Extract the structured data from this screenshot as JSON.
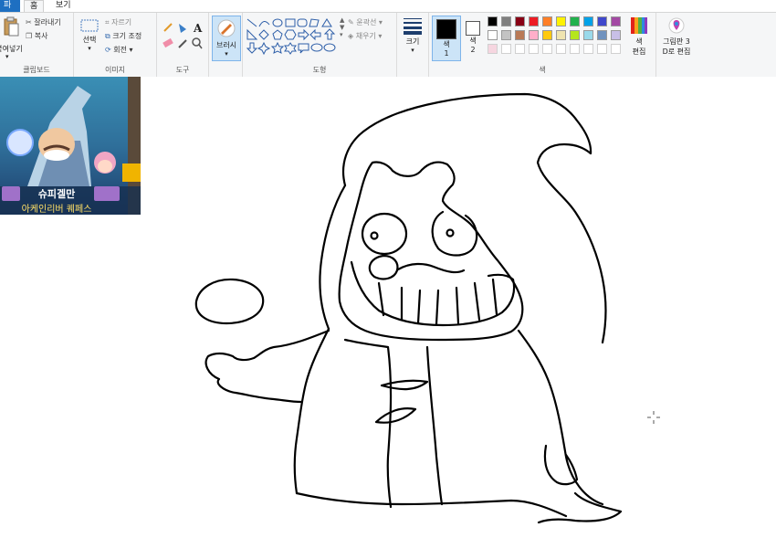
{
  "tabs": {
    "file": "파일",
    "home": "홈",
    "view": "보기"
  },
  "clipboard": {
    "paste": "붙여넣기",
    "cut": "잘라내기",
    "copy": "복사",
    "label": "클립보드"
  },
  "image": {
    "select": "선택",
    "crop": "자르기",
    "resize": "크기 조정",
    "rotate": "회전",
    "label": "이미지"
  },
  "tools": {
    "label": "도구",
    "text_glyph": "A"
  },
  "brushes": {
    "label": "브러시"
  },
  "shapes": {
    "outline": "윤곽선",
    "fill": "채우기",
    "label": "도형"
  },
  "size": {
    "label": "크기"
  },
  "colors": {
    "color1": "색\n1",
    "color1_label": "색",
    "color1_num": "1",
    "color2_label": "색",
    "color2_num": "2",
    "edit": "색",
    "edit2": "편집",
    "label": "색",
    "color1_value": "#000000",
    "color2_value": "#ffffff",
    "palette_row1": [
      "#000000",
      "#7f7f7f",
      "#880015",
      "#ed1c24",
      "#ff7f27",
      "#fff200",
      "#22b14c",
      "#00a2e8",
      "#3f48cc",
      "#a349a4"
    ],
    "palette_row2": [
      "#ffffff",
      "#c3c3c3",
      "#b97a57",
      "#ffaec9",
      "#ffc90e",
      "#efe4b0",
      "#b5e61d",
      "#99d9ea",
      "#7092be",
      "#c8bfe7"
    ]
  },
  "paint3d": {
    "line1": "그림판 3",
    "line2": "D로 편집"
  },
  "thumbnail": {
    "name": "슈피겔만",
    "sub": "아케인리버 퀘페스"
  }
}
